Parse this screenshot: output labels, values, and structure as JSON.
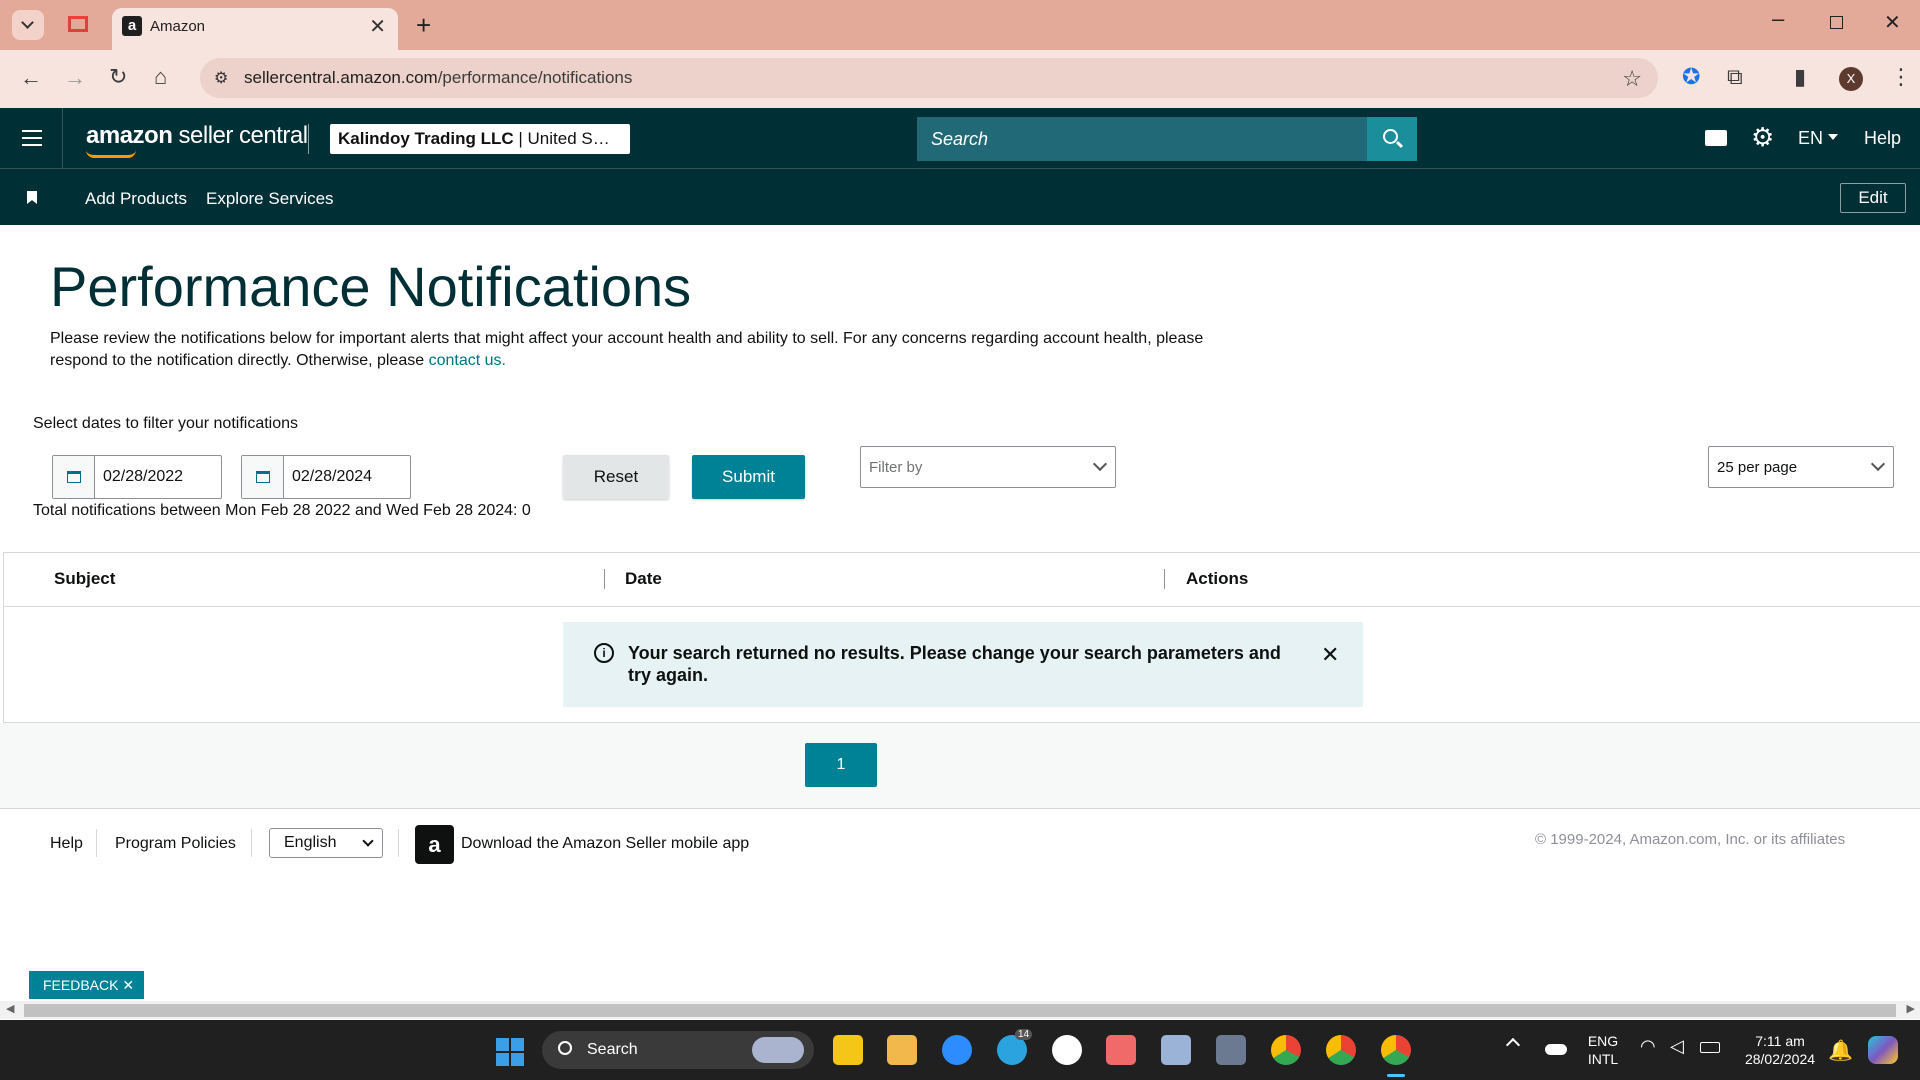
{
  "browser": {
    "tab_title": "Amazon",
    "url_domain": "sellercentral.amazon.com",
    "url_path": "/performance/notifications"
  },
  "header": {
    "logo_bold": "amazon",
    "logo_rest": " seller central",
    "account_name": "Kalindoy Trading LLC",
    "account_region": " | United S…",
    "search_placeholder": "Search",
    "language": "EN",
    "help": "Help"
  },
  "nav": {
    "items": [
      "Add Products",
      "Explore Services"
    ],
    "edit": "Edit"
  },
  "page": {
    "title": "Performance Notifications",
    "description": "Please review the notifications below for important alerts that might affect your account health and ability to sell. For any concerns regarding account health, please respond to the notification directly. Otherwise, please ",
    "contact_link": "contact us.",
    "filter_label": "Select dates to filter your notifications",
    "start_date": "02/28/2022",
    "end_date": "02/28/2024",
    "reset": "Reset",
    "submit": "Submit",
    "filter_by": "Filter by",
    "per_page": "25 per page",
    "total_text": "Total notifications between Mon Feb 28 2022 and Wed Feb 28 2024: 0"
  },
  "table": {
    "columns": [
      "Subject",
      "Date",
      "Actions"
    ],
    "empty_message": "Your search returned no results. Please change your search parameters and try again."
  },
  "pagination": {
    "current": "1"
  },
  "footer": {
    "help": "Help",
    "policies": "Program Policies",
    "language": "English",
    "app_text": "Download the Amazon Seller mobile app",
    "copyright": "© 1999-2024, Amazon.com, Inc. or its affiliates"
  },
  "feedback": "FEEDBACK ✕",
  "taskbar": {
    "search": "Search",
    "lang_line1": "ENG",
    "lang_line2": "INTL",
    "time": "7:11 am",
    "date": "28/02/2024",
    "telegram_badge": "14"
  },
  "colors": {
    "header_bg": "#002f36",
    "accent": "#008296",
    "tabbar": "#e3aa99"
  }
}
